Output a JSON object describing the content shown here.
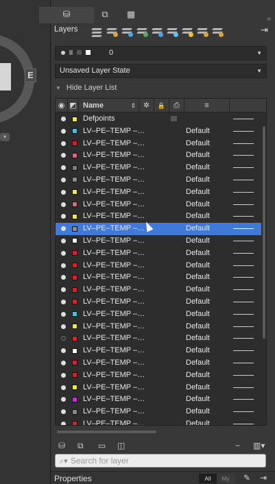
{
  "panel": {
    "title": "Layers",
    "tabs": [
      "layers-tab",
      "layer-properties-tab",
      "layer-table-tab"
    ],
    "current_layer": "0",
    "layer_state": "Unsaved Layer State",
    "hide_list_label": "Hide Layer List",
    "collapse_glyph": "»",
    "dock_glyph": "⇥"
  },
  "columns": {
    "on_glyph": "◉",
    "name": "Name",
    "sort_glyph": "⇕",
    "freeze_glyph": "✲",
    "lock_glyph": "🔒",
    "plot_glyph": "⎙",
    "more_glyph": "≡"
  },
  "layers": [
    {
      "name": "Defpoints",
      "color": "#f5e63c",
      "linetype": "",
      "on": true
    },
    {
      "name": "LV–PE–TEMP –…",
      "color": "#35c9e6",
      "linetype": "Default",
      "on": true
    },
    {
      "name": "LV–PE–TEMP –…",
      "color": "#e21f1f",
      "linetype": "Default",
      "on": true
    },
    {
      "name": "LV–PE–TEMP –…",
      "color": "#d96a7e",
      "linetype": "Default",
      "on": true
    },
    {
      "name": "LV–PE–TEMP –…",
      "color": "#7a7a7a",
      "linetype": "Default",
      "on": true
    },
    {
      "name": "LV–PE–TEMP –…",
      "color": "#8a8a8a",
      "linetype": "Default",
      "on": true
    },
    {
      "name": "LV–PE–TEMP –…",
      "color": "#f5e63c",
      "linetype": "Default",
      "on": true
    },
    {
      "name": "LV–PE–TEMP –…",
      "color": "#d96a7e",
      "linetype": "Default",
      "on": true
    },
    {
      "name": "LV–PE–TEMP –…",
      "color": "#f5e63c",
      "linetype": "Default",
      "on": true
    },
    {
      "name": "LV–PE–TEMP –…",
      "color": "#8a8a8a",
      "linetype": "Default",
      "on": true,
      "selected": true
    },
    {
      "name": "LV–PE–TEMP –…",
      "color": "#ffffff",
      "linetype": "Default",
      "on": true
    },
    {
      "name": "LV–PE–TEMP –…",
      "color": "#e21f1f",
      "linetype": "Default",
      "on": true
    },
    {
      "name": "LV–PE–TEMP –…",
      "color": "#e21f1f",
      "linetype": "Default",
      "on": true
    },
    {
      "name": "LV–PE–TEMP –…",
      "color": "#e21f1f",
      "linetype": "Default",
      "on": true
    },
    {
      "name": "LV–PE–TEMP –…",
      "color": "#e21f1f",
      "linetype": "Default",
      "on": true
    },
    {
      "name": "LV–PE–TEMP –…",
      "color": "#e21f1f",
      "linetype": "Default",
      "on": true
    },
    {
      "name": "LV–PE–TEMP –…",
      "color": "#35c9e6",
      "linetype": "Default",
      "on": true
    },
    {
      "name": "LV–PE–TEMP –…",
      "color": "#f5e63c",
      "linetype": "Default",
      "on": true
    },
    {
      "name": "LV–PE–TEMP –…",
      "color": "#e21f1f",
      "linetype": "Default",
      "on": false
    },
    {
      "name": "LV–PE–TEMP –…",
      "color": "#ffffff",
      "linetype": "Default",
      "on": true
    },
    {
      "name": "LV–PE–TEMP –…",
      "color": "#e21f1f",
      "linetype": "Default",
      "on": true
    },
    {
      "name": "LV–PE–TEMP –…",
      "color": "#e21f1f",
      "linetype": "Default",
      "on": true
    },
    {
      "name": "LV–PE–TEMP –…",
      "color": "#f5e63c",
      "linetype": "Default",
      "on": true
    },
    {
      "name": "LV–PE–TEMP –…",
      "color": "#c92fd6",
      "linetype": "Default",
      "on": true
    },
    {
      "name": "LV–PE–TEMP –…",
      "color": "#8a8a8a",
      "linetype": "Default",
      "on": true
    },
    {
      "name": "LV–PE–TEMP –…",
      "color": "#e21f1f",
      "linetype": "Default",
      "on": true
    }
  ],
  "search": {
    "placeholder": "Search for layer"
  },
  "properties": {
    "title": "Properties",
    "all_label": "All",
    "my_label": "My"
  },
  "canvas": {
    "tag": "E"
  },
  "accent": "#3f7ad8"
}
